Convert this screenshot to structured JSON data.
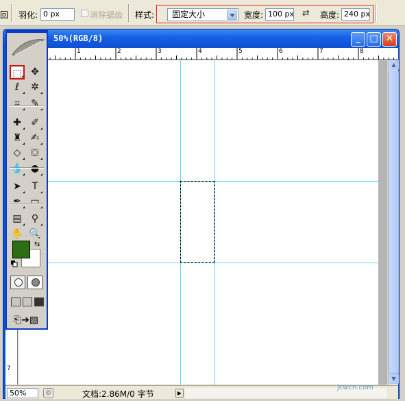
{
  "options_bar": {
    "feather_label": "羽化:",
    "feather_value": "0 px",
    "anti_alias_label": "消除锯齿",
    "style_label": "样式:",
    "style_value": "固定大小",
    "width_label": "宽度:",
    "width_value": "100 px",
    "height_label": "高度:",
    "height_value": "240 px"
  },
  "document": {
    "title": "50%(RGB/8)",
    "zoom": "50%",
    "status_text": "文档:2.86M/0 字节",
    "ruler_h_labels": [
      "1",
      "2",
      "3",
      "4",
      "5",
      "6",
      "7",
      "8"
    ],
    "ruler_v_labels": [
      "7"
    ]
  },
  "colors": {
    "foreground": "#2c6e12",
    "background": "#ffffff",
    "guide": "#58d8e8"
  },
  "tools": [
    {
      "name": "rectangular-marquee-tool",
      "icon": "⬚"
    },
    {
      "name": "move-tool",
      "icon": "✥"
    },
    {
      "name": "lasso-tool",
      "icon": "ℓ"
    },
    {
      "name": "magic-wand-tool",
      "icon": "✲"
    },
    {
      "name": "crop-tool",
      "icon": "⌗"
    },
    {
      "name": "slice-tool",
      "icon": "✎"
    },
    {
      "name": "healing-brush-tool",
      "icon": "✚"
    },
    {
      "name": "brush-tool",
      "icon": "✐"
    },
    {
      "name": "clone-stamp-tool",
      "icon": "♜"
    },
    {
      "name": "history-brush-tool",
      "icon": "✍"
    },
    {
      "name": "eraser-tool",
      "icon": "◇"
    },
    {
      "name": "paint-bucket-tool",
      "icon": "⛋"
    },
    {
      "name": "blur-tool",
      "icon": "💧"
    },
    {
      "name": "dodge-tool",
      "icon": "●"
    },
    {
      "name": "path-selection-tool",
      "icon": "➤"
    },
    {
      "name": "type-tool",
      "icon": "T"
    },
    {
      "name": "pen-tool",
      "icon": "✒"
    },
    {
      "name": "rectangle-shape-tool",
      "icon": "▭"
    },
    {
      "name": "notes-tool",
      "icon": "▤"
    },
    {
      "name": "eyedropper-tool",
      "icon": "⚲"
    },
    {
      "name": "hand-tool",
      "icon": "✋"
    },
    {
      "name": "zoom-tool",
      "icon": "🔍"
    }
  ],
  "watermark": "jcwcn.com"
}
